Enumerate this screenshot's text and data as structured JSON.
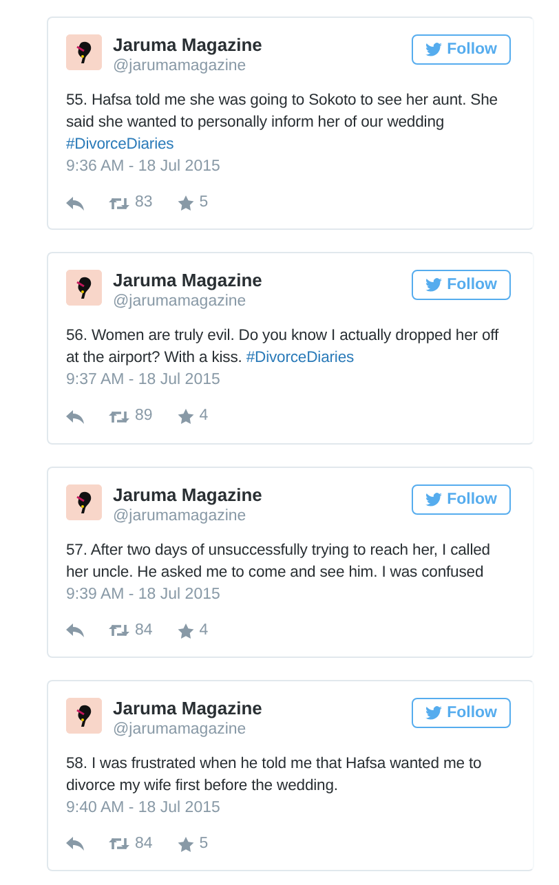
{
  "tweets": [
    {
      "name": "Jaruma Magazine",
      "handle": "@jarumamagazine",
      "follow": "Follow",
      "text": "55. Hafsa told me she was going to Sokoto to see her aunt. She said she wanted to personally inform her of our wedding",
      "hashtag": "#DivorceDiaries",
      "time": "9:36 AM - 18 Jul 2015",
      "retweets": "83",
      "favorites": "5"
    },
    {
      "name": "Jaruma Magazine",
      "handle": "@jarumamagazine",
      "follow": "Follow",
      "text": "56. Women are truly evil. Do you know I actually dropped her off at the airport? With a kiss.",
      "hashtag": "#DivorceDiaries",
      "time": "9:37 AM - 18 Jul 2015",
      "retweets": "89",
      "favorites": "4"
    },
    {
      "name": "Jaruma Magazine",
      "handle": "@jarumamagazine",
      "follow": "Follow",
      "text": "57. After two days of unsuccessfully trying to reach her, I called her uncle. He asked me to come and see him. I was confused",
      "time": "9:39 AM - 18 Jul 2015",
      "retweets": "84",
      "favorites": "4"
    },
    {
      "name": "Jaruma Magazine",
      "handle": "@jarumamagazine",
      "follow": "Follow",
      "text": "58. I was frustrated when he told me that Hafsa wanted me to divorce my wife first before the wedding.",
      "time": "9:40 AM - 18 Jul 2015",
      "retweets": "84",
      "favorites": "5"
    }
  ]
}
